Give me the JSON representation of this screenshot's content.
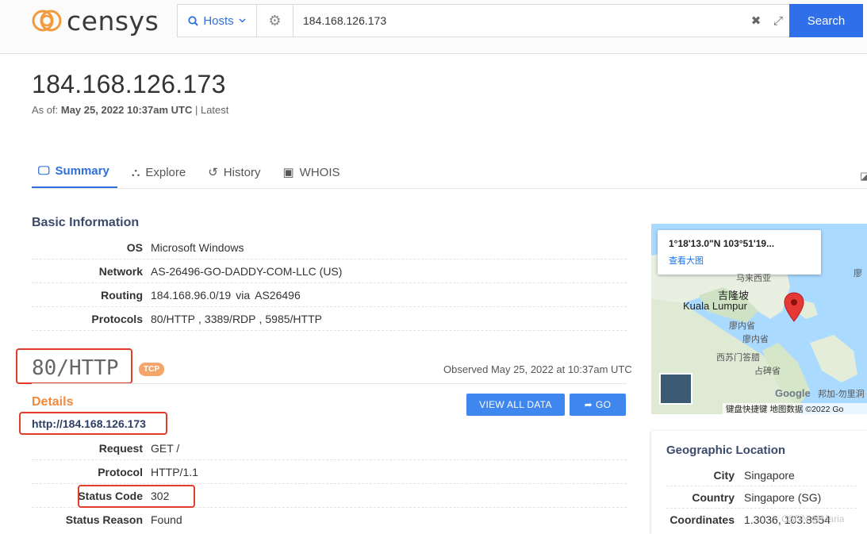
{
  "header": {
    "logo_text": "censys",
    "search_type": "Hosts",
    "query": "184.168.126.173",
    "search_label": "Search"
  },
  "page": {
    "title": "184.168.126.173",
    "asof_prefix": "As of:",
    "asof_date": "May 25, 2022 10:37am UTC",
    "asof_suffix": "| Latest"
  },
  "tabs": [
    {
      "label": "Summary",
      "icon": "monitor-icon",
      "active": true
    },
    {
      "label": "Explore",
      "icon": "binoculars-icon",
      "active": false
    },
    {
      "label": "History",
      "icon": "history-icon",
      "active": false
    },
    {
      "label": "WHOIS",
      "icon": "id-badge-icon",
      "active": false
    }
  ],
  "basic_info": {
    "title": "Basic Information",
    "os_label": "OS",
    "os_value": "Microsoft Windows",
    "network_label": "Network",
    "network_value": "AS-26496-GO-DADDY-COM-LLC (US)",
    "routing_label": "Routing",
    "routing_prefix": "184.168.96.0/19",
    "routing_via": "via",
    "routing_asn": "AS26496",
    "protocols_label": "Protocols",
    "protocols": [
      "80/HTTP",
      "3389/RDP",
      "5985/HTTP"
    ],
    "protocol_sep": ","
  },
  "service": {
    "port_label": "80/HTTP",
    "transport": "TCP",
    "observed": "Observed May 25, 2022 at 10:37am UTC",
    "details_title": "Details",
    "view_all_label": "VIEW ALL DATA",
    "go_label": "GO",
    "url": "http://184.168.126.173",
    "request_label": "Request",
    "request_value": "GET /",
    "protocol_label": "Protocol",
    "protocol_value": "HTTP/1.1",
    "status_code_label": "Status Code",
    "status_code_value": "302",
    "status_reason_label": "Status Reason",
    "status_reason_value": "Found"
  },
  "map": {
    "coords": "1°18'13.0\"N 103°51'19...",
    "bigmap_link": "查看大图",
    "label_malaysia": "马来西亚",
    "label_jlp": "吉隆坡",
    "label_kl": "Kuala Lumpur",
    "label_lmn1": "廖内省",
    "label_lmn2": "廖内省",
    "label_xsm": "西苏门答腊",
    "label_zb": "占碑省",
    "label_lm": "廖",
    "label_bz": "邦加-勿里洞",
    "google": "Google",
    "footer": "键盘快捷键  地图数据 ©2022 Go"
  },
  "geo": {
    "title": "Geographic Location",
    "city_label": "City",
    "city_value": "Singapore",
    "country_label": "Country",
    "country_value": "Singapore (SG)",
    "coords_label": "Coordinates",
    "coords_value": "1.3036, 103.8554"
  },
  "watermark": "CSDN @Maria",
  "colors": {
    "accent_blue": "#2f6fea",
    "orange": "#f08a3c",
    "highlight_red": "#e23d28"
  }
}
